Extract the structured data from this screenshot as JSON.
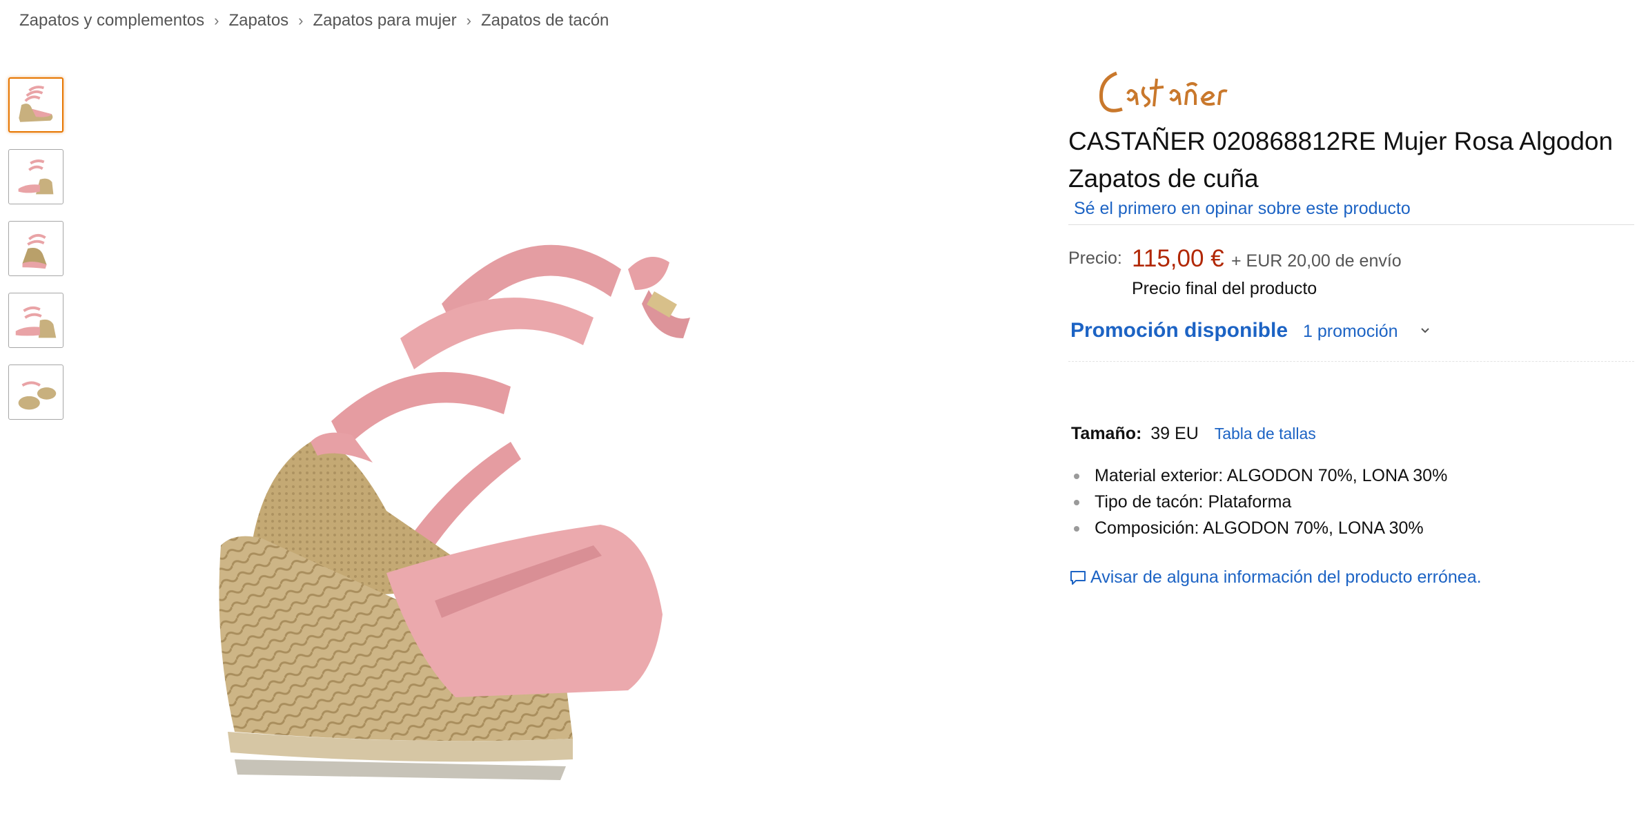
{
  "breadcrumb": {
    "items": [
      "Zapatos y complementos",
      "Zapatos",
      "Zapatos para mujer",
      "Zapatos de tacón"
    ],
    "separator": "›"
  },
  "thumbnails": {
    "count": 5,
    "active_index": 0,
    "active_border_color": "#e77600"
  },
  "brand": {
    "logo_text": "Castañer",
    "logo_color": "#c9782c"
  },
  "product": {
    "title": "CASTAÑER 020868812RE Mujer Rosa Algodon Zapatos de cuña",
    "review_link": "Sé el primero en opinar sobre este producto"
  },
  "price": {
    "label": "Precio:",
    "value": "115,00 €",
    "shipping": "+ EUR 20,00 de envío",
    "note": "Precio final del producto",
    "color": "#b12704"
  },
  "promotion": {
    "label": "Promoción disponible",
    "count": "1 promoción",
    "icon": "chevron-down-icon"
  },
  "size": {
    "label": "Tamaño:",
    "value": "39 EU",
    "chart_link": "Tabla de tallas"
  },
  "features": [
    "Material exterior: ALGODON 70%, LONA 30%",
    "Tipo de tacón: Plataforma",
    "Composición: ALGODON 70%, LONA 30%"
  ],
  "report": {
    "label": "Avisar de alguna información del producto errónea.",
    "icon": "speech-bubble-icon"
  },
  "colors": {
    "link": "#1c63c4",
    "price": "#b12704",
    "text": "#111111",
    "muted": "#555555"
  }
}
